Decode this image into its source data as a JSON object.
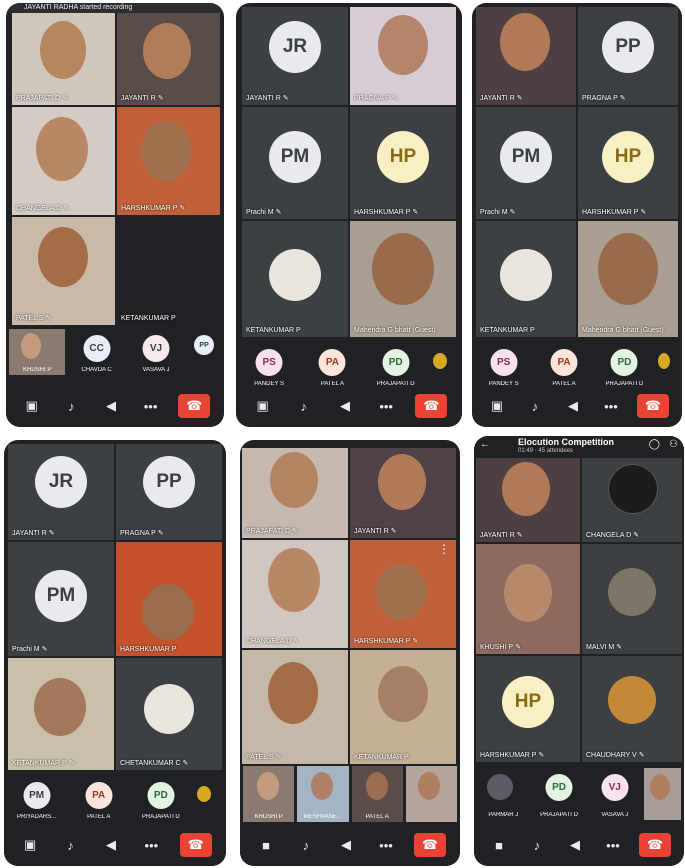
{
  "mic_glyph": "✎",
  "colors": {
    "hangup": "#ea4335",
    "tile_bg": "#3c4043",
    "window_bg": "#202124"
  },
  "panel1": {
    "banner": "JAYANTI RADHA started recording",
    "tiles": [
      "PRAJAPATI D",
      "JAYANTI R",
      "CHANGELA D",
      "HARSHKUMAR P",
      "PATEL S",
      "KETANKUMAR P"
    ],
    "strip": [
      {
        "initials": "",
        "name": "KHUSHI P"
      },
      {
        "initials": "CC",
        "name": "CHAVDA C"
      },
      {
        "initials": "VJ",
        "name": "VASAVA J"
      },
      {
        "initials": "PP",
        "name": ""
      }
    ]
  },
  "panel2": {
    "tiles": [
      {
        "initials": "JR",
        "name": "JAYANTI R"
      },
      {
        "initials": "",
        "name": "PRAGNA P"
      },
      {
        "initials": "PM",
        "name": "Prachi M"
      },
      {
        "initials": "HP",
        "name": "HARSHKUMAR P"
      },
      {
        "initials": "",
        "name": "KETANKUMAR P"
      },
      {
        "initials": "",
        "name": "Mahendra G bhatt (Guest)"
      }
    ],
    "strip": [
      {
        "initials": "PS",
        "name": "PANDEY S"
      },
      {
        "initials": "PA",
        "name": "PATEL A"
      },
      {
        "initials": "PD",
        "name": "PRAJAPATI D"
      }
    ]
  },
  "panel3": {
    "tiles": [
      {
        "initials": "",
        "name": "JAYANTI R"
      },
      {
        "initials": "PP",
        "name": "PRAGNA P"
      },
      {
        "initials": "PM",
        "name": "Prachi M"
      },
      {
        "initials": "HP",
        "name": "HARSHKUMAR P"
      },
      {
        "initials": "",
        "name": "KETANKUMAR P"
      },
      {
        "initials": "",
        "name": "Mahendra G bhatt (Guest)"
      }
    ],
    "strip": [
      {
        "initials": "PS",
        "name": "PANDEY S"
      },
      {
        "initials": "PA",
        "name": "PATEL A"
      },
      {
        "initials": "PD",
        "name": "PRAJAPATI D"
      }
    ]
  },
  "panel4": {
    "tiles": [
      {
        "initials": "JR",
        "name": "JAYANTI R"
      },
      {
        "initials": "PP",
        "name": "PRAGNA P"
      },
      {
        "initials": "PM",
        "name": "Prachi M"
      },
      {
        "initials": "",
        "name": "HARSHKUMAR P"
      },
      {
        "initials": "",
        "name": "KETANKUMAR P"
      },
      {
        "initials": "",
        "name": "CHETANKUMAR C"
      }
    ],
    "strip": [
      {
        "initials": "PM",
        "name": "PRIYADARS..."
      },
      {
        "initials": "PA",
        "name": "PATEL A"
      },
      {
        "initials": "PD",
        "name": "PRAJAPATI D"
      }
    ]
  },
  "panel5": {
    "tiles": [
      "PRAJAPATI D",
      "JAYANTI R",
      "CHANGELA D",
      "HARSHKUMAR P",
      "PATEL S",
      "KETANKUMAR P"
    ],
    "strip": [
      "KHUSHI P",
      "MESHVANE...",
      "PATEL A",
      ""
    ],
    "more": "⋮"
  },
  "panel6": {
    "title": "Elocution Competition",
    "subtitle": "01:49 · 45 attendees",
    "tiles": [
      {
        "initials": "",
        "name": "JAYANTI R"
      },
      {
        "initials": "",
        "name": "CHANGELA D"
      },
      {
        "initials": "",
        "name": "KHUSHI P"
      },
      {
        "initials": "",
        "name": "MALVI M"
      },
      {
        "initials": "HP",
        "name": "HARSHKUMAR P"
      },
      {
        "initials": "",
        "name": "CHAUDHARY V"
      }
    ],
    "strip": [
      {
        "initials": "",
        "name": "PARMAR J"
      },
      {
        "initials": "PD",
        "name": "PRAJAPATI D"
      },
      {
        "initials": "VJ",
        "name": "VASAVA J"
      },
      {
        "initials": "",
        "name": ""
      }
    ]
  }
}
